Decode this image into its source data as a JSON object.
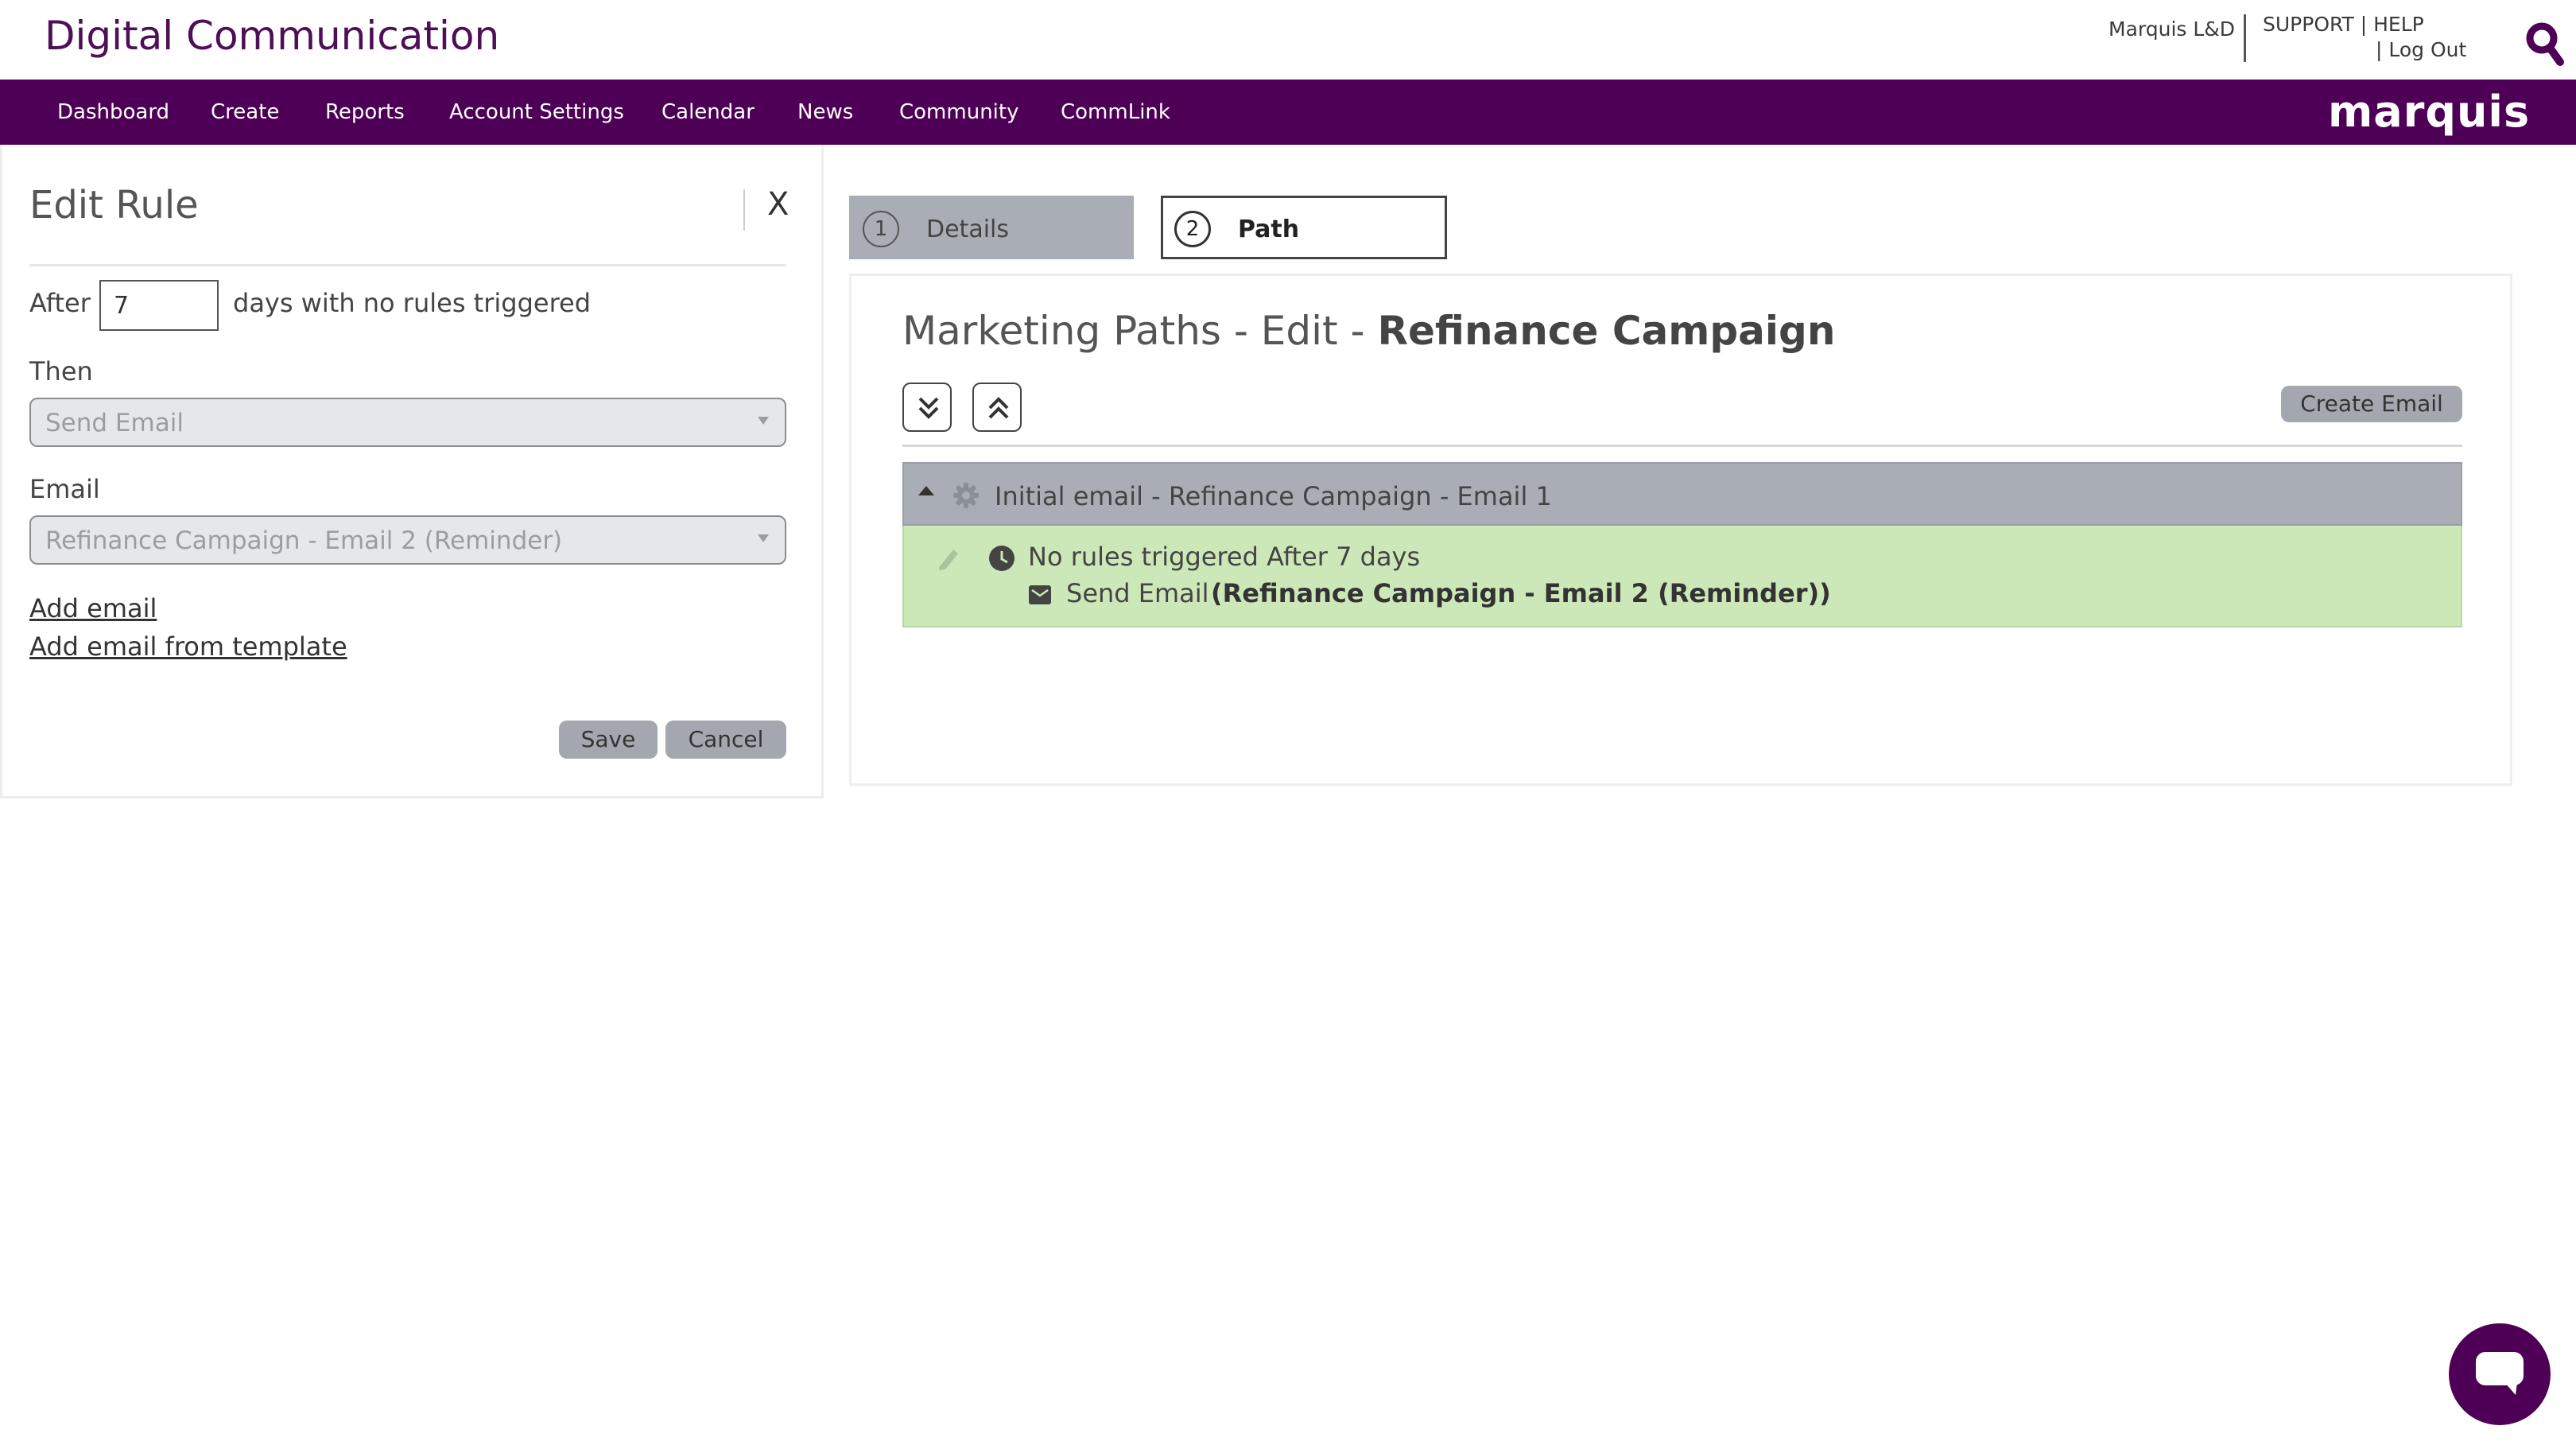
{
  "header": {
    "brand": "Digital Communication",
    "user": "Marquis L&D",
    "support": "SUPPORT | HELP",
    "logout": "| Log Out",
    "logo": "marquis"
  },
  "nav": {
    "items": [
      "Dashboard",
      "Create",
      "Reports",
      "Account Settings",
      "Calendar",
      "News",
      "Community",
      "CommLink"
    ]
  },
  "edit_rule": {
    "title": "Edit Rule",
    "close_label": "X",
    "after_label": "After",
    "days_value": "7",
    "days_suffix": "days with no rules triggered",
    "then_label": "Then",
    "then_value": "Send Email",
    "email_label": "Email",
    "email_value": "Refinance Campaign - Email 2 (Reminder)",
    "add_email": "Add email",
    "add_from_template": "Add email from template",
    "save": "Save",
    "cancel": "Cancel"
  },
  "steps": [
    {
      "number": "1",
      "label": "Details"
    },
    {
      "number": "2",
      "label": "Path"
    }
  ],
  "path_editor": {
    "heading_prefix": "Marketing Paths - Edit - ",
    "heading_name": "Refinance Campaign",
    "create_email": "Create Email",
    "initial_email": "Initial email - Refinance Campaign - Email 1",
    "rule_text": "No rules triggered After 7 days",
    "send_label": "Send Email",
    "send_email_name": "(Refinance Campaign - Email 2 (Reminder))"
  },
  "colors": {
    "brand_purple": "#4d0055",
    "rule_green": "#cde8b8",
    "header_gray": "#a9aeb6"
  }
}
